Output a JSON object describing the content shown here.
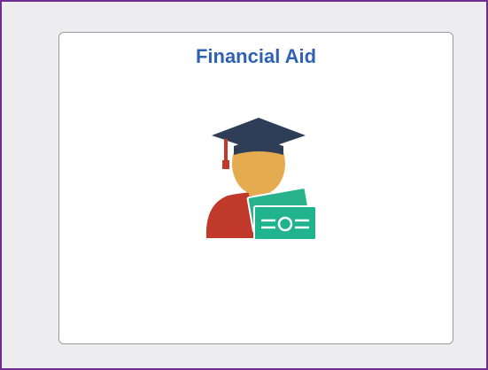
{
  "tile": {
    "title": "Financial Aid",
    "icon": "graduate-with-money-icon"
  },
  "colors": {
    "frame_border": "#6f2c91",
    "background": "#ededf0",
    "title_text": "#2f62b4",
    "tile_border": "#9a9a9a"
  }
}
